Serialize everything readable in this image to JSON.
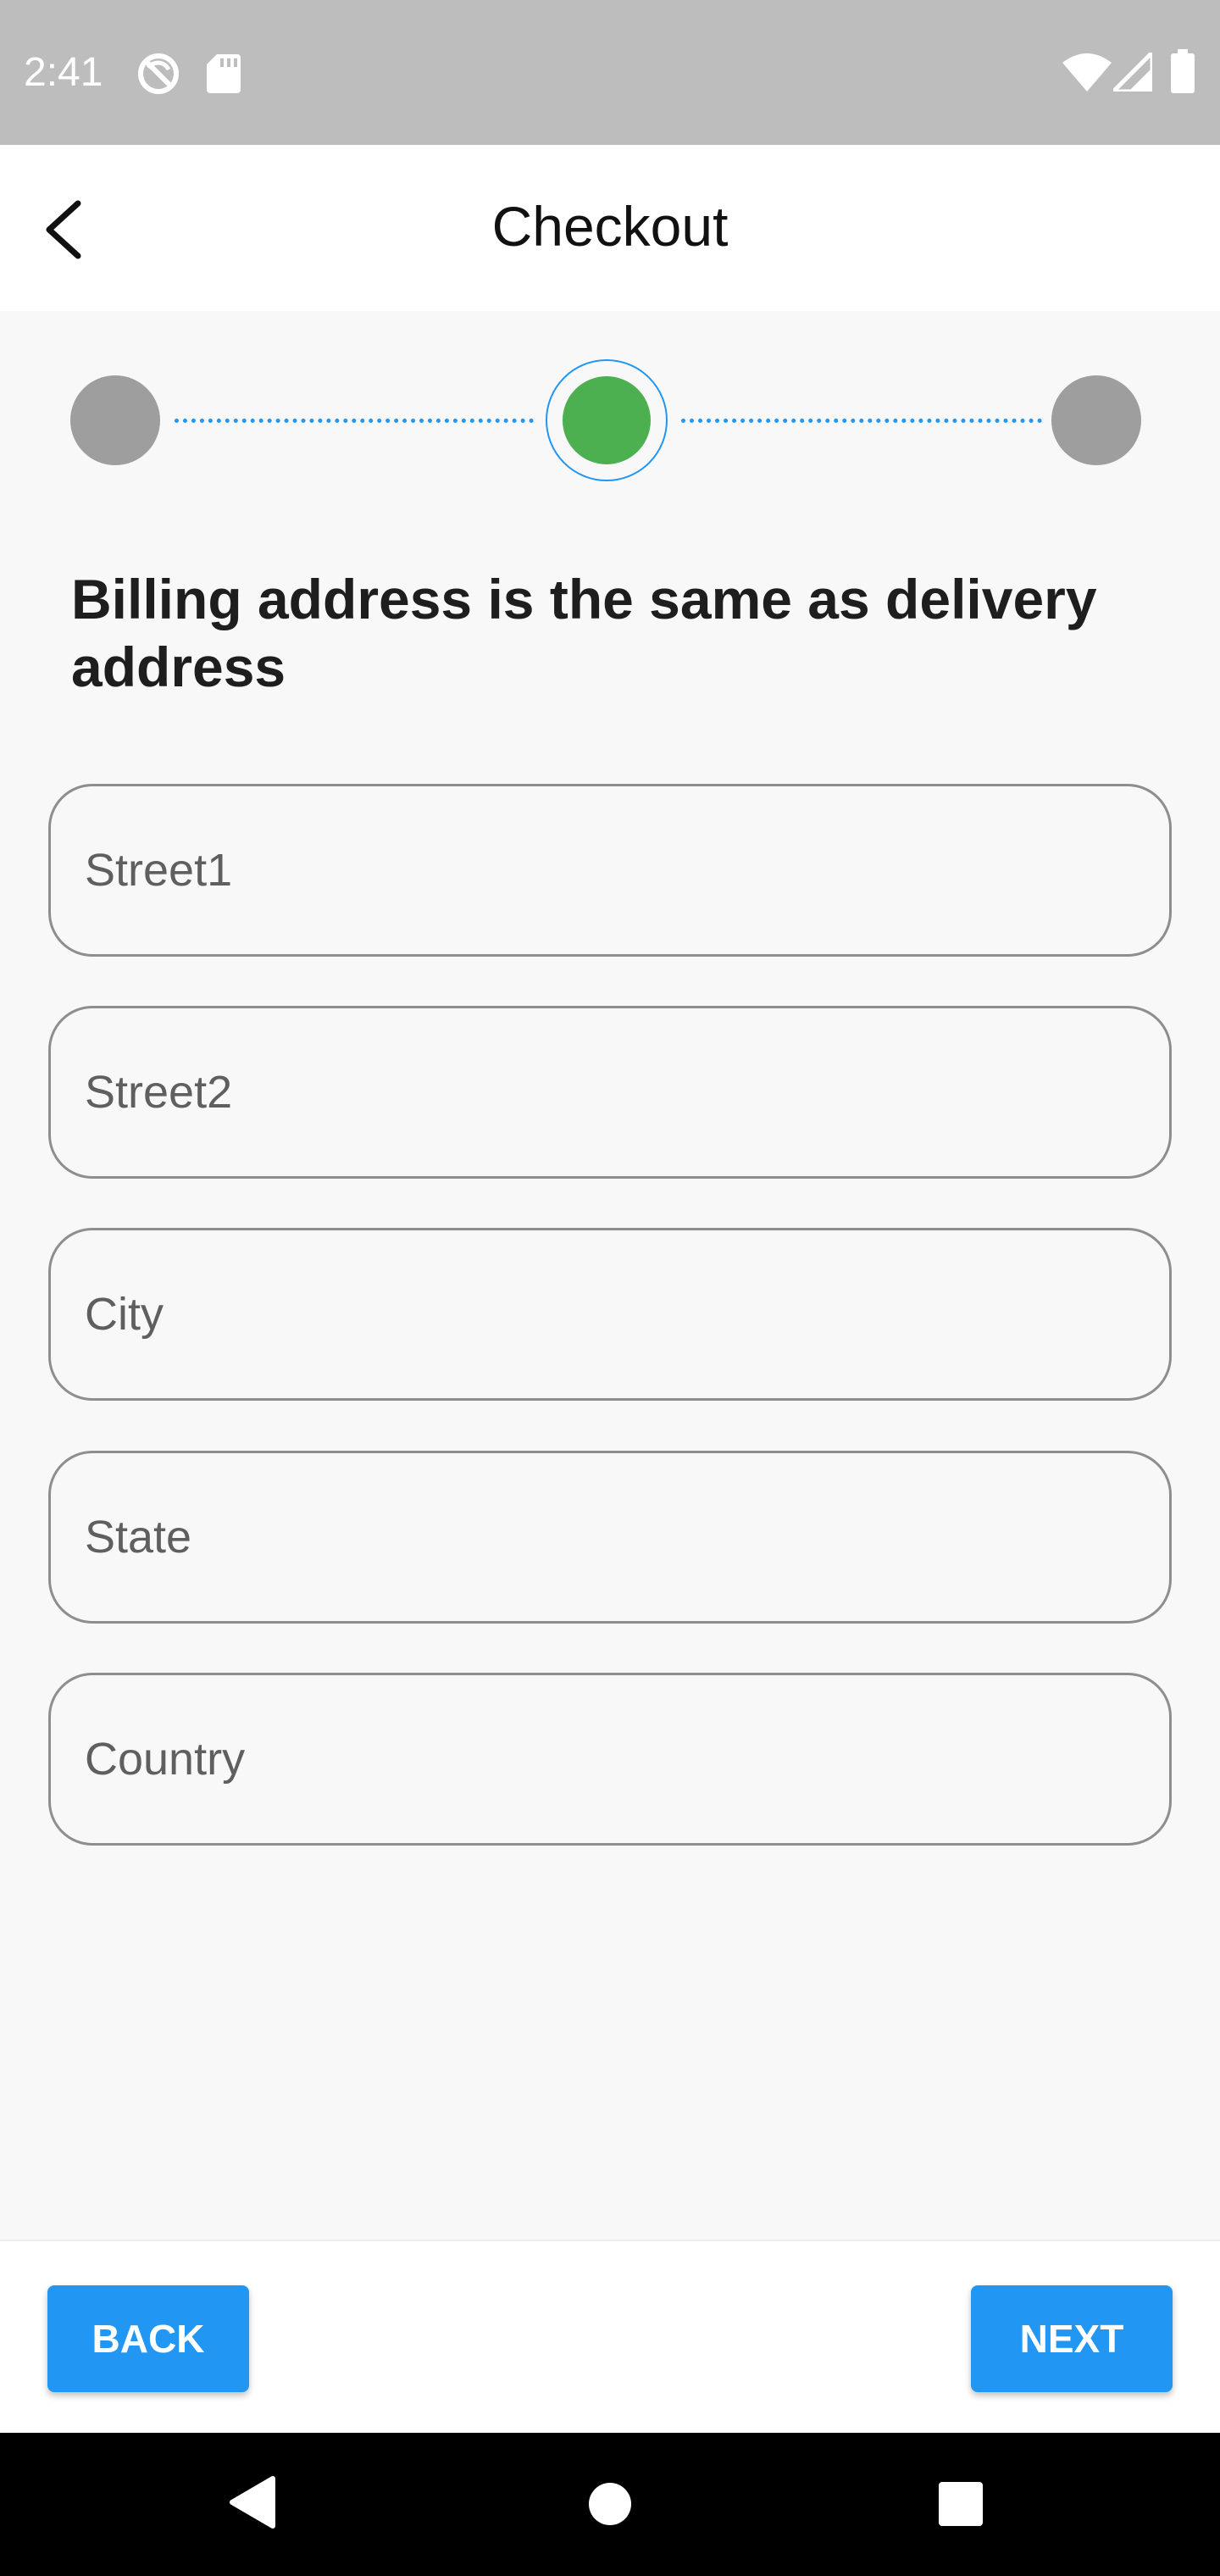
{
  "status_bar": {
    "time": "2:41",
    "left_icons": [
      "no-sync-icon",
      "sd-card-icon"
    ],
    "right_icons": [
      "wifi-icon",
      "cell-signal-icon",
      "battery-icon"
    ]
  },
  "app_bar": {
    "title": "Checkout",
    "back_icon": "back-arrow-icon"
  },
  "stepper": {
    "steps": 3,
    "current_step": 2,
    "colors": {
      "inactive": "#9e9e9e",
      "active": "#4caf50",
      "connector": "#2196f3"
    }
  },
  "form": {
    "title": "Billing address is the same as delivery address",
    "fields": [
      {
        "name": "street1",
        "placeholder": "Street1",
        "value": ""
      },
      {
        "name": "street2",
        "placeholder": "Street2",
        "value": ""
      },
      {
        "name": "city",
        "placeholder": "City",
        "value": ""
      },
      {
        "name": "state",
        "placeholder": "State",
        "value": ""
      },
      {
        "name": "country",
        "placeholder": "Country",
        "value": ""
      }
    ]
  },
  "actions": {
    "back_label": "BACK",
    "next_label": "NEXT",
    "button_color": "#2196f3"
  },
  "nav_bar": {
    "buttons": [
      "nav-back-icon",
      "nav-home-icon",
      "nav-recents-icon"
    ]
  }
}
